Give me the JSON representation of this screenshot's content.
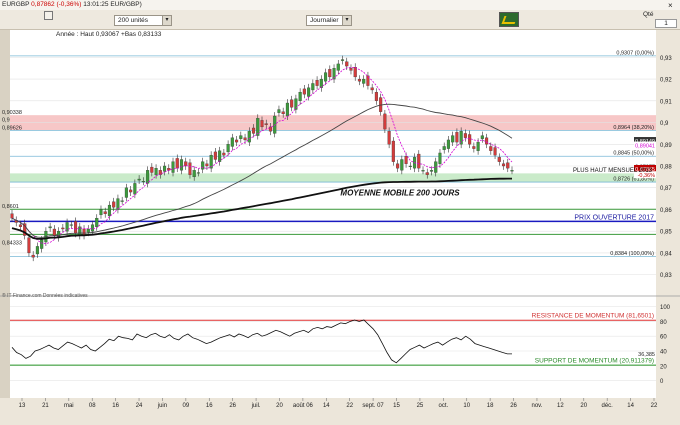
{
  "toolbar": {
    "symbol": "EURGBP",
    "last": "0,87862",
    "change": "(-0,36%)",
    "time": "13:01:25 EUR/GBP)",
    "units": "200 unités",
    "period": "Journalier",
    "qte_label": "Qté",
    "qte_value": "1",
    "close_glyph": "×"
  },
  "chart_data": {
    "type": "candlestick",
    "header_note": "Année : Haut 0,93067 +Bas 0,83133",
    "credit": "® IT-Finance.com  Données indicatives",
    "ylim": [
      0.822,
      0.938
    ],
    "y_ticks": [
      "0,93",
      "0,92",
      "0,91",
      "0,9",
      "0,89",
      "0,88",
      "0,87",
      "0,86",
      "0,85",
      "0,84",
      "0,83"
    ],
    "left_labels": [
      {
        "text": "0,90338",
        "y": 0.90338
      },
      {
        "text": "0,9",
        "y": 0.9
      },
      {
        "text": "0,89626",
        "y": 0.89626
      },
      {
        "text": "0,8601",
        "y": 0.8601
      },
      {
        "text": "0,84333",
        "y": 0.84333
      }
    ],
    "right_labels": [
      {
        "text": "0,89149",
        "y": 0.89149,
        "color": "#ffffff",
        "bg": "#333333"
      },
      {
        "text": "0,89041",
        "y": 0.88941,
        "color": "#d400d4",
        "bg": "#ffffff"
      },
      {
        "text": "0,87977",
        "y": 0.87977,
        "color": "#333333",
        "bg": "#ffffff"
      },
      {
        "text": "0,87865",
        "y": 0.87862,
        "color": "#ffffff",
        "bg": "#c00000"
      },
      {
        "text": "-0,36%",
        "y": 0.87575,
        "color": "#c00000",
        "bg": "#ffffff"
      }
    ],
    "fib_levels": [
      {
        "label": "0,9307 (0,00%)",
        "y": 0.9307
      },
      {
        "label": "0,8964 (38,20%)",
        "y": 0.8964
      },
      {
        "label": "0,8845 (50,00%)",
        "y": 0.8845
      },
      {
        "label": "0,8726 (61,80%)",
        "y": 0.8726
      },
      {
        "label": "0,8384 (100,00%)",
        "y": 0.8384
      }
    ],
    "zones": [
      {
        "from": 0.8964,
        "to": 0.9034,
        "color": "#f4b4b4"
      },
      {
        "from": 0.8726,
        "to": 0.8766,
        "color": "#b8e4b8"
      }
    ],
    "annotations": [
      {
        "text": "PLUS HAUT MENSUEL 2013",
        "y": 0.8766,
        "color": "#111111"
      },
      {
        "text": "MOYENNE MOBILE 200 JOURS",
        "y": 0.8665,
        "color": "#111111",
        "italic": true
      },
      {
        "text": "PRIX OUVERTURE 2017",
        "y": 0.8545,
        "color": "#1a1aa0"
      }
    ],
    "hlines": [
      {
        "y": 0.8545,
        "color": "#1a1ac0",
        "width": 1.5
      },
      {
        "y": 0.8601,
        "color": "#3a9a3a",
        "width": 1
      },
      {
        "y": 0.8485,
        "color": "#3a9a3a",
        "width": 1
      }
    ],
    "x_ticks": [
      "13",
      "21",
      "mai",
      "08",
      "16",
      "24",
      "juin",
      "09",
      "16",
      "26",
      "juil.",
      "20",
      "août 06",
      "14",
      "22",
      "sept. 07",
      "15",
      "25",
      "oct.",
      "10",
      "18",
      "26",
      "nov.",
      "12",
      "20",
      "déc.",
      "14",
      "22"
    ],
    "candle_closes": [
      0.856,
      0.854,
      0.852,
      0.848,
      0.84,
      0.838,
      0.843,
      0.846,
      0.85,
      0.852,
      0.848,
      0.85,
      0.851,
      0.854,
      0.853,
      0.849,
      0.852,
      0.848,
      0.851,
      0.853,
      0.856,
      0.86,
      0.858,
      0.862,
      0.861,
      0.865,
      0.864,
      0.87,
      0.868,
      0.872,
      0.874,
      0.873,
      0.878,
      0.877,
      0.879,
      0.876,
      0.88,
      0.878,
      0.882,
      0.879,
      0.883,
      0.88,
      0.876,
      0.878,
      0.877,
      0.882,
      0.88,
      0.885,
      0.883,
      0.887,
      0.885,
      0.89,
      0.893,
      0.891,
      0.894,
      0.892,
      0.896,
      0.895,
      0.902,
      0.898,
      0.899,
      0.896,
      0.903,
      0.906,
      0.904,
      0.909,
      0.907,
      0.911,
      0.914,
      0.913,
      0.916,
      0.918,
      0.917,
      0.92,
      0.923,
      0.921,
      0.925,
      0.927,
      0.929,
      0.926,
      0.924,
      0.921,
      0.919,
      0.92,
      0.917,
      0.915,
      0.91,
      0.905,
      0.897,
      0.89,
      0.882,
      0.879,
      0.883,
      0.881,
      0.88,
      0.884,
      0.879,
      0.878,
      0.876,
      0.878,
      0.882,
      0.886,
      0.889,
      0.892,
      0.894,
      0.891,
      0.896,
      0.893,
      0.89,
      0.888,
      0.891,
      0.894,
      0.89,
      0.887,
      0.885,
      0.882,
      0.88,
      0.879,
      0.878
    ],
    "momentum_panel": {
      "ylim": [
        -2,
        105
      ],
      "y_ticks": [
        "100",
        "80",
        "60",
        "40",
        "20",
        "0"
      ],
      "resistance": {
        "label": "RESISTANCE DE MOMENTUM (81,6501)",
        "value": 81.65
      },
      "support": {
        "label": "SUPPORT DE MOMENTUM (20,911379)",
        "value": 20.91
      },
      "last_label": "36,385",
      "values": [
        45,
        38,
        35,
        30,
        33,
        40,
        42,
        45,
        48,
        44,
        42,
        47,
        52,
        50,
        47,
        44,
        48,
        42,
        40,
        45,
        50,
        56,
        54,
        60,
        58,
        57,
        55,
        63,
        60,
        58,
        62,
        64,
        60,
        58,
        62,
        57,
        55,
        60,
        63,
        58,
        56,
        53,
        50,
        52,
        55,
        58,
        60,
        62,
        59,
        63,
        61,
        58,
        62,
        64,
        60,
        62,
        65,
        68,
        66,
        63,
        60,
        64,
        66,
        68,
        65,
        70,
        72,
        70,
        73,
        72,
        75,
        78,
        77,
        80,
        82,
        80,
        82,
        76,
        70,
        62,
        50,
        38,
        28,
        24,
        30,
        36,
        42,
        45,
        48,
        44,
        47,
        50,
        52,
        48,
        52,
        56,
        58,
        55,
        60,
        56,
        50,
        48,
        46,
        44,
        42,
        40,
        38,
        36,
        36
      ]
    }
  }
}
